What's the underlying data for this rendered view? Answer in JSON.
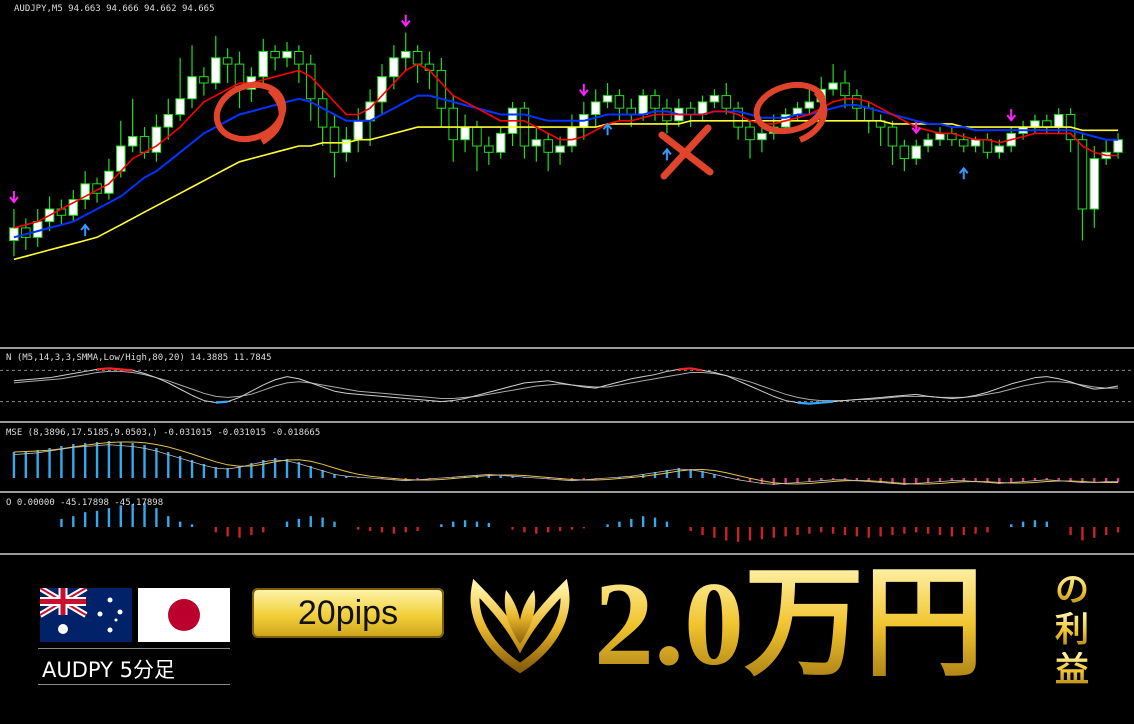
{
  "chart_data": {
    "type": "candlestick",
    "main_label": "AUDJPY,M5  94.663 94.666 94.662 94.665",
    "ylim": [
      0,
      100
    ],
    "candles": [
      [
        30,
        34,
        40,
        25
      ],
      [
        34,
        31,
        37,
        27
      ],
      [
        31,
        36,
        40,
        28
      ],
      [
        36,
        40,
        44,
        33
      ],
      [
        40,
        38,
        43,
        35
      ],
      [
        38,
        43,
        46,
        36
      ],
      [
        43,
        48,
        52,
        40
      ],
      [
        48,
        45,
        50,
        42
      ],
      [
        45,
        52,
        56,
        43
      ],
      [
        52,
        60,
        68,
        50
      ],
      [
        60,
        63,
        75,
        58
      ],
      [
        63,
        58,
        66,
        56
      ],
      [
        58,
        66,
        70,
        55
      ],
      [
        66,
        70,
        75,
        62
      ],
      [
        70,
        75,
        88,
        68
      ],
      [
        75,
        82,
        92,
        72
      ],
      [
        82,
        80,
        85,
        76
      ],
      [
        80,
        88,
        95,
        78
      ],
      [
        88,
        86,
        91,
        80
      ],
      [
        86,
        78,
        90,
        72
      ],
      [
        78,
        82,
        85,
        74
      ],
      [
        82,
        90,
        94,
        79
      ],
      [
        90,
        88,
        92,
        84
      ],
      [
        88,
        90,
        93,
        85
      ],
      [
        90,
        86,
        92,
        80
      ],
      [
        86,
        75,
        89,
        68
      ],
      [
        75,
        66,
        78,
        60
      ],
      [
        66,
        58,
        70,
        50
      ],
      [
        58,
        62,
        66,
        55
      ],
      [
        62,
        68,
        72,
        58
      ],
      [
        68,
        74,
        78,
        60
      ],
      [
        74,
        82,
        86,
        70
      ],
      [
        82,
        88,
        92,
        78
      ],
      [
        88,
        90,
        96,
        84
      ],
      [
        90,
        86,
        92,
        80
      ],
      [
        86,
        84,
        90,
        78
      ],
      [
        84,
        72,
        88,
        66
      ],
      [
        72,
        62,
        76,
        55
      ],
      [
        62,
        66,
        70,
        58
      ],
      [
        66,
        60,
        68,
        52
      ],
      [
        60,
        58,
        63,
        54
      ],
      [
        58,
        64,
        66,
        56
      ],
      [
        64,
        72,
        74,
        60
      ],
      [
        72,
        60,
        74,
        56
      ],
      [
        60,
        62,
        66,
        55
      ],
      [
        62,
        58,
        64,
        52
      ],
      [
        58,
        60,
        63,
        54
      ],
      [
        60,
        66,
        70,
        58
      ],
      [
        66,
        70,
        74,
        62
      ],
      [
        70,
        74,
        78,
        66
      ],
      [
        74,
        76,
        80,
        72
      ],
      [
        76,
        72,
        78,
        68
      ],
      [
        72,
        70,
        75,
        66
      ],
      [
        70,
        76,
        78,
        68
      ],
      [
        76,
        72,
        78,
        68
      ],
      [
        72,
        68,
        75,
        64
      ],
      [
        68,
        72,
        75,
        66
      ],
      [
        72,
        70,
        74,
        66
      ],
      [
        70,
        74,
        76,
        68
      ],
      [
        74,
        76,
        78,
        72
      ],
      [
        76,
        72,
        80,
        70
      ],
      [
        72,
        66,
        74,
        62
      ],
      [
        66,
        62,
        68,
        56
      ],
      [
        62,
        64,
        66,
        58
      ],
      [
        64,
        66,
        70,
        62
      ],
      [
        66,
        70,
        72,
        64
      ],
      [
        70,
        72,
        74,
        68
      ],
      [
        72,
        74,
        78,
        70
      ],
      [
        74,
        78,
        82,
        72
      ],
      [
        78,
        80,
        86,
        76
      ],
      [
        80,
        76,
        84,
        72
      ],
      [
        76,
        72,
        78,
        68
      ],
      [
        72,
        68,
        74,
        64
      ],
      [
        68,
        66,
        70,
        60
      ],
      [
        66,
        60,
        68,
        54
      ],
      [
        60,
        56,
        62,
        52
      ],
      [
        56,
        60,
        62,
        54
      ],
      [
        60,
        62,
        64,
        58
      ],
      [
        62,
        64,
        66,
        60
      ],
      [
        64,
        62,
        66,
        60
      ],
      [
        62,
        60,
        64,
        58
      ],
      [
        60,
        62,
        63,
        58
      ],
      [
        62,
        58,
        64,
        56
      ],
      [
        58,
        60,
        62,
        56
      ],
      [
        60,
        64,
        66,
        58
      ],
      [
        64,
        66,
        68,
        62
      ],
      [
        66,
        68,
        70,
        64
      ],
      [
        68,
        66,
        70,
        64
      ],
      [
        66,
        70,
        72,
        64
      ],
      [
        70,
        62,
        72,
        58
      ],
      [
        62,
        40,
        64,
        30
      ],
      [
        40,
        56,
        60,
        34
      ],
      [
        56,
        58,
        62,
        54
      ],
      [
        58,
        62,
        64,
        56
      ]
    ],
    "ema_red": [
      34,
      35,
      36,
      38,
      40,
      42,
      44,
      46,
      48,
      52,
      56,
      58,
      60,
      63,
      66,
      70,
      74,
      76,
      78,
      80,
      80,
      81,
      82,
      83,
      84,
      82,
      78,
      74,
      70,
      70,
      72,
      76,
      80,
      84,
      86,
      84,
      80,
      76,
      74,
      72,
      70,
      68,
      68,
      68,
      66,
      64,
      62,
      62,
      63,
      65,
      67,
      68,
      68,
      69,
      70,
      70,
      70,
      70,
      70,
      71,
      71,
      70,
      68,
      67,
      67,
      68,
      69,
      70,
      72,
      74,
      75,
      75,
      74,
      72,
      70,
      68,
      66,
      65,
      64,
      64,
      63,
      62,
      62,
      61,
      62,
      63,
      64,
      64,
      64,
      64,
      60,
      58,
      57,
      57
    ],
    "ema_blue": [
      31,
      32,
      33,
      34,
      35,
      36,
      38,
      40,
      42,
      44,
      47,
      50,
      52,
      55,
      58,
      61,
      64,
      66,
      68,
      70,
      71,
      72,
      73,
      74,
      75,
      74,
      72,
      70,
      68,
      68,
      68,
      70,
      72,
      74,
      76,
      76,
      75,
      74,
      73,
      72,
      71,
      70,
      70,
      70,
      69,
      68,
      68,
      68,
      68,
      69,
      70,
      70,
      70,
      70,
      71,
      71,
      70,
      70,
      70,
      71,
      71,
      71,
      70,
      69,
      69,
      69,
      70,
      70,
      71,
      72,
      73,
      73,
      72,
      71,
      70,
      69,
      68,
      67,
      67,
      66,
      66,
      65,
      65,
      65,
      65,
      65,
      65,
      65,
      65,
      65,
      64,
      63,
      62,
      62
    ],
    "ema_yellow": [
      24,
      25,
      26,
      27,
      28,
      29,
      30,
      31,
      33,
      35,
      37,
      39,
      41,
      43,
      45,
      47,
      49,
      51,
      53,
      55,
      56,
      57,
      58,
      59,
      60,
      60,
      61,
      61,
      61,
      62,
      62,
      63,
      64,
      65,
      66,
      66,
      66,
      66,
      66,
      66,
      66,
      66,
      66,
      66,
      66,
      66,
      66,
      66,
      66,
      66,
      67,
      67,
      67,
      67,
      67,
      67,
      67,
      68,
      68,
      68,
      68,
      68,
      68,
      68,
      68,
      68,
      68,
      68,
      68,
      68,
      68,
      68,
      68,
      68,
      67,
      67,
      67,
      67,
      67,
      67,
      66,
      66,
      66,
      66,
      66,
      66,
      66,
      66,
      66,
      66,
      65,
      65,
      65,
      65
    ],
    "arrows_down_idx": [
      0,
      33,
      48,
      76,
      84
    ],
    "arrows_up_idx": [
      6,
      50,
      55,
      80
    ],
    "p1_label": "N (M5,14,3,3,SMMA,Low/High,80,20) 14.3885 11.7845",
    "p1_main": [
      60,
      62,
      64,
      66,
      70,
      74,
      78,
      82,
      84,
      82,
      80,
      74,
      66,
      56,
      44,
      32,
      22,
      18,
      20,
      28,
      40,
      52,
      62,
      68,
      64,
      56,
      48,
      40,
      36,
      34,
      32,
      30,
      28,
      26,
      24,
      22,
      20,
      22,
      26,
      32,
      38,
      44,
      50,
      56,
      58,
      60,
      56,
      52,
      48,
      46,
      52,
      58,
      64,
      68,
      72,
      78,
      82,
      84,
      80,
      76,
      70,
      60,
      50,
      40,
      30,
      22,
      18,
      16,
      18,
      20,
      22,
      24,
      26,
      28,
      30,
      32,
      34,
      30,
      28,
      26,
      28,
      32,
      38,
      46,
      54,
      60,
      66,
      68,
      64,
      58,
      50,
      44,
      46,
      50
    ],
    "p1_signal": [
      56,
      58,
      60,
      62,
      64,
      68,
      72,
      76,
      78,
      78,
      76,
      72,
      66,
      60,
      52,
      44,
      36,
      30,
      28,
      30,
      34,
      42,
      50,
      56,
      58,
      56,
      52,
      48,
      44,
      40,
      38,
      36,
      34,
      32,
      30,
      28,
      26,
      26,
      28,
      30,
      34,
      38,
      42,
      46,
      50,
      52,
      54,
      52,
      50,
      48,
      48,
      52,
      56,
      60,
      64,
      68,
      72,
      76,
      76,
      74,
      70,
      64,
      58,
      50,
      42,
      34,
      28,
      24,
      22,
      22,
      22,
      24,
      24,
      26,
      28,
      30,
      30,
      30,
      28,
      28,
      28,
      30,
      34,
      38,
      44,
      50,
      54,
      58,
      58,
      56,
      52,
      48,
      46,
      46
    ],
    "p2_label": "MSE (8,3896,17.5185,9.0503,) -0.031015 -0.031015 -0.018665",
    "p2_hist": [
      52,
      54,
      56,
      60,
      64,
      68,
      70,
      72,
      74,
      72,
      70,
      66,
      60,
      52,
      44,
      36,
      28,
      22,
      20,
      24,
      30,
      36,
      40,
      38,
      32,
      24,
      16,
      8,
      4,
      2,
      0,
      -2,
      -4,
      -6,
      -4,
      -2,
      0,
      2,
      4,
      6,
      8,
      6,
      4,
      2,
      0,
      -2,
      -4,
      -6,
      -4,
      -2,
      0,
      2,
      4,
      8,
      12,
      16,
      20,
      18,
      14,
      8,
      2,
      -4,
      -8,
      -12,
      -14,
      -12,
      -10,
      -8,
      -6,
      -4,
      -4,
      -6,
      -8,
      -10,
      -12,
      -14,
      -12,
      -10,
      -8,
      -6,
      -6,
      -8,
      -10,
      -12,
      -10,
      -8,
      -6,
      -4,
      -6,
      -8,
      -10,
      -10,
      -8,
      -8
    ],
    "p3_label": "O 0.00000 -45.17898 -45.17898",
    "p3_hist": [
      0,
      0,
      0,
      0,
      30,
      40,
      55,
      60,
      70,
      80,
      85,
      90,
      70,
      40,
      20,
      10,
      0,
      -20,
      -35,
      -40,
      -30,
      -20,
      0,
      20,
      30,
      40,
      35,
      20,
      0,
      -10,
      -15,
      -20,
      -25,
      -20,
      -15,
      0,
      10,
      20,
      25,
      20,
      15,
      0,
      -10,
      -20,
      -25,
      -20,
      -15,
      -10,
      -5,
      0,
      10,
      20,
      30,
      40,
      35,
      20,
      0,
      -15,
      -30,
      -40,
      -50,
      -55,
      -50,
      -45,
      -40,
      -35,
      -30,
      -25,
      -20,
      -25,
      -30,
      -35,
      -40,
      -35,
      -30,
      -25,
      -20,
      -25,
      -30,
      -35,
      -30,
      -25,
      -20,
      0,
      10,
      20,
      25,
      20,
      0,
      -30,
      -50,
      -40,
      -30,
      -20
    ]
  },
  "banner": {
    "pair": "AUDPY 5分足",
    "pips": "20pips",
    "amount": "2.0万円",
    "suffix_1": "の",
    "suffix_2": "利",
    "suffix_3": "益"
  },
  "colors": {
    "bull": "#ffffff",
    "wick": "#22dd22",
    "ema_red": "#ff0000",
    "ema_blue": "#0033ff",
    "ema_yellow": "#ffff33",
    "arrow_down": "#ff22ff",
    "arrow_up": "#3399ff",
    "hist_pos": "#33aaee",
    "hist_neg": "#cc2222",
    "hist_neg2": "#dd3388",
    "gold": "#e6c14a"
  }
}
